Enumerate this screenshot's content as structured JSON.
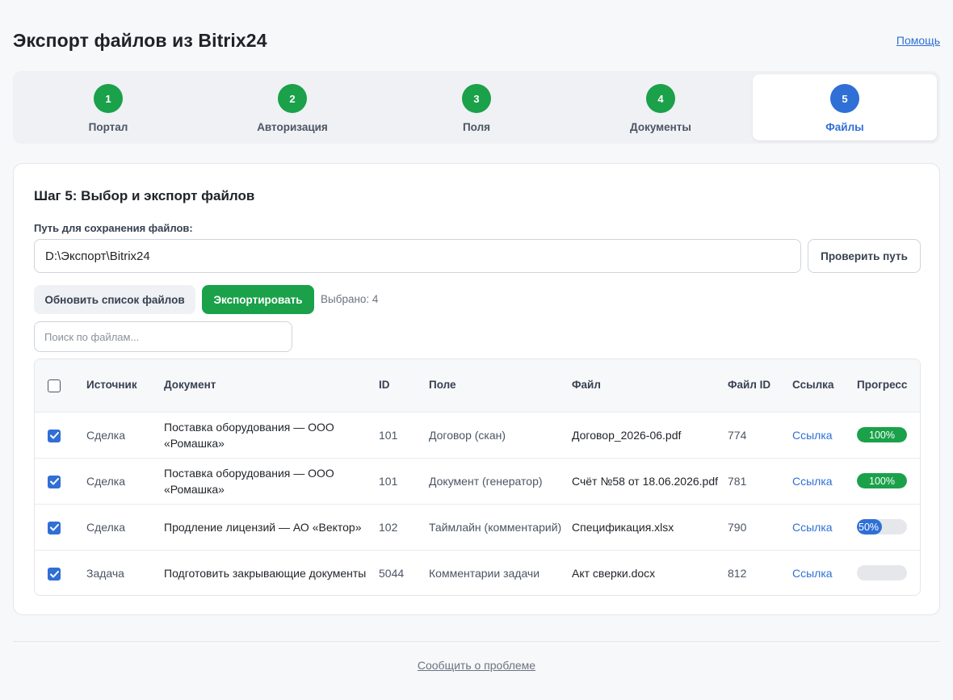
{
  "header": {
    "title": "Экспорт файлов из Bitrix24",
    "help_link": "Помощь"
  },
  "steps": [
    {
      "number": "1",
      "label": "Портал"
    },
    {
      "number": "2",
      "label": "Авторизация"
    },
    {
      "number": "3",
      "label": "Поля"
    },
    {
      "number": "4",
      "label": "Документы"
    },
    {
      "number": "5",
      "label": "Файлы"
    }
  ],
  "active_step": 5,
  "colors": {
    "done": "#1aa14a",
    "active": "#2f6fd6",
    "link": "#2f6fd6",
    "progress_bg": "#e5e7eb"
  },
  "card": {
    "title": "Шаг 5: Выбор и экспорт файлов",
    "path_label": "Путь для сохранения файлов:",
    "path_value": "D:\\Экспорт\\Bitrix24",
    "check_path_button": "Проверить путь",
    "refresh_button": "Обновить список файлов",
    "export_button": "Экспортировать",
    "selected_count": "Выбрано: 4",
    "search_placeholder": "Поиск по файлам..."
  },
  "table": {
    "columns": {
      "source": "Источник",
      "document": "Документ",
      "id": "ID",
      "field": "Поле",
      "file": "Файл",
      "file_id": "Файл ID",
      "link": "Ссылка",
      "progress": "Прогресс"
    },
    "header_checked": false,
    "rows": [
      {
        "checked": true,
        "source": "Сделка",
        "document": "Поставка оборудования — ООО «Ромашка»",
        "id": "101",
        "field": "Договор (скан)",
        "file": "Договор_2026-06.pdf",
        "file_id": "774",
        "link": "Ссылка",
        "progress": 100,
        "progress_text": "100%"
      },
      {
        "checked": true,
        "source": "Сделка",
        "document": "Поставка оборудования — ООО «Ромашка»",
        "id": "101",
        "field": "Документ (генератор)",
        "file": "Счёт №58 от 18.06.2026.pdf",
        "file_id": "781",
        "link": "Ссылка",
        "progress": 100,
        "progress_text": "100%"
      },
      {
        "checked": true,
        "source": "Сделка",
        "document": "Продление лицензий — АО «Вектор»",
        "id": "102",
        "field": "Таймлайн (комментарий)",
        "file": "Спецификация.xlsx",
        "file_id": "790",
        "link": "Ссылка",
        "progress": 50,
        "progress_text": "50%"
      },
      {
        "checked": true,
        "source": "Задача",
        "document": "Подготовить закрывающие документы",
        "id": "5044",
        "field": "Комментарии задачи",
        "file": "Акт сверки.docx",
        "file_id": "812",
        "link": "Ссылка",
        "progress": 0,
        "progress_text": ""
      }
    ]
  },
  "footer": {
    "report_link": "Сообщить о проблеме"
  }
}
